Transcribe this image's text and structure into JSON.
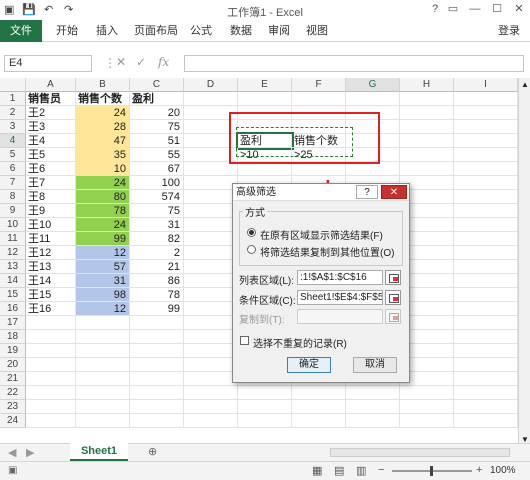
{
  "window": {
    "title": "工作簿1 - Excel",
    "help": "?"
  },
  "ribbon": {
    "tabs": [
      "文件",
      "开始",
      "插入",
      "页面布局",
      "公式",
      "数据",
      "审阅",
      "视图"
    ],
    "signin": "登录"
  },
  "formula_bar": {
    "name_box": "E4",
    "fx": "fx"
  },
  "columns": [
    "A",
    "B",
    "C",
    "D",
    "E",
    "F",
    "G",
    "H",
    "I"
  ],
  "rows": [
    "1",
    "2",
    "3",
    "4",
    "5",
    "6",
    "7",
    "8",
    "9",
    "10",
    "11",
    "12",
    "13",
    "14",
    "15",
    "16",
    "17",
    "18",
    "19",
    "20",
    "21",
    "22",
    "23",
    "24"
  ],
  "table": {
    "headers": [
      "销售员",
      "销售个数",
      "盈利"
    ],
    "data": [
      [
        "王2",
        "24",
        "20"
      ],
      [
        "王3",
        "28",
        "75"
      ],
      [
        "王4",
        "47",
        "51"
      ],
      [
        "王5",
        "35",
        "55"
      ],
      [
        "王6",
        "10",
        "67"
      ],
      [
        "王7",
        "24",
        "100"
      ],
      [
        "王8",
        "80",
        "574"
      ],
      [
        "王9",
        "78",
        "75"
      ],
      [
        "王10",
        "24",
        "31"
      ],
      [
        "王11",
        "99",
        "82"
      ],
      [
        "王12",
        "12",
        "2"
      ],
      [
        "王13",
        "57",
        "21"
      ],
      [
        "王14",
        "31",
        "86"
      ],
      [
        "王15",
        "98",
        "78"
      ],
      [
        "王16",
        "12",
        "99"
      ]
    ],
    "band_colors": [
      "#ffe699",
      "#92d050",
      "#b4c6e7"
    ]
  },
  "criteria": {
    "headers": [
      "盈利",
      "销售个数"
    ],
    "values": [
      ">10",
      ">25"
    ]
  },
  "dialog": {
    "title": "高级筛选",
    "help": "?",
    "close": "✕",
    "group_label": "方式",
    "option1": "在原有区域显示筛选结果(F)",
    "option2": "将筛选结果复制到其他位置(O)",
    "list_label": "列表区域(L):",
    "list_value": ":1!$A$1:$C$16",
    "criteria_label": "条件区域(C):",
    "criteria_value": "Sheet1!$E$4:$F$5",
    "copy_label": "复制到(T):",
    "unique_label": "选择不重复的记录(R)",
    "ok": "确定",
    "cancel": "取消"
  },
  "sheet_tab": "Sheet1",
  "status": {
    "zoom": "100%"
  },
  "colors": {
    "accent": "#217346",
    "highlight_box": "#e02020",
    "arrow": "#e02020"
  }
}
